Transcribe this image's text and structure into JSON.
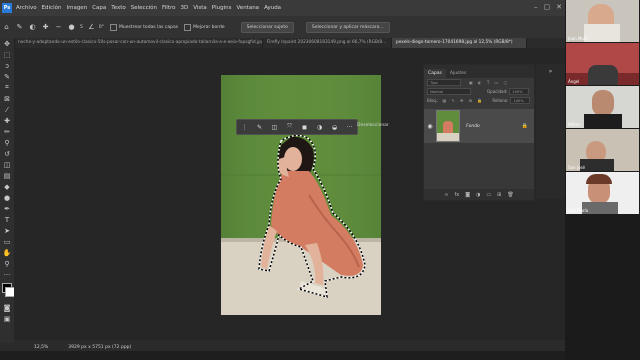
{
  "menubar": {
    "app_logo": "Ps",
    "items": [
      "Archivo",
      "Edición",
      "Imagen",
      "Capa",
      "Texto",
      "Selección",
      "Filtro",
      "3D",
      "Vista",
      "Plugins",
      "Ventana",
      "Ayuda"
    ]
  },
  "options": {
    "size_value": "5",
    "angle_value": "0°",
    "sample_all_layers": "Muestrear todas las capas",
    "enhance_edge": "Mejorar borde",
    "select_subject": "Seleccionar sujeto",
    "select_and_mask": "Seleccionar y aplicar máscara..."
  },
  "tabs": [
    {
      "label": "noche-y-adoptando-un-estilo-clasico-50s-posar-con-un-automovil-clasico-apropiado-tallarnila-a-e-aeia-fopsgfid.jpg",
      "active": false
    },
    {
      "label": "Firefly Inpaint 20230608183149.png al 66,7% (RGB/8...",
      "active": false
    },
    {
      "label": "pexels-diego-tornero-17041698.jpg al 12,5% (RGB/8*)",
      "active": true
    }
  ],
  "context_bar": {
    "deselect_label": "Deseleccionar",
    "more_label": "···"
  },
  "layers_panel": {
    "tab_layers": "Capas",
    "tab_adjustments": "Ajustes",
    "kind_label": "Tipo",
    "blend_mode": "Normal",
    "opacity_label": "Opacidad:",
    "opacity_value": "100%",
    "lock_label": "Bloq.:",
    "fill_label": "Relleno:",
    "fill_value": "100%",
    "layer_name": "Fondo"
  },
  "status": {
    "zoom": "12,5%",
    "doc_info": "3929 px x 5751 px (72 ppp)"
  },
  "participants": [
    {
      "name": "Juan Muñi"
    },
    {
      "name": "Ángel"
    },
    {
      "name": "Wilton"
    },
    {
      "name": "San José"
    },
    {
      "name": "Ana María"
    }
  ],
  "colors": {
    "accent": "#2a7bd8",
    "wall_green": "#5c8a3b",
    "dress_coral": "#d57d63"
  }
}
